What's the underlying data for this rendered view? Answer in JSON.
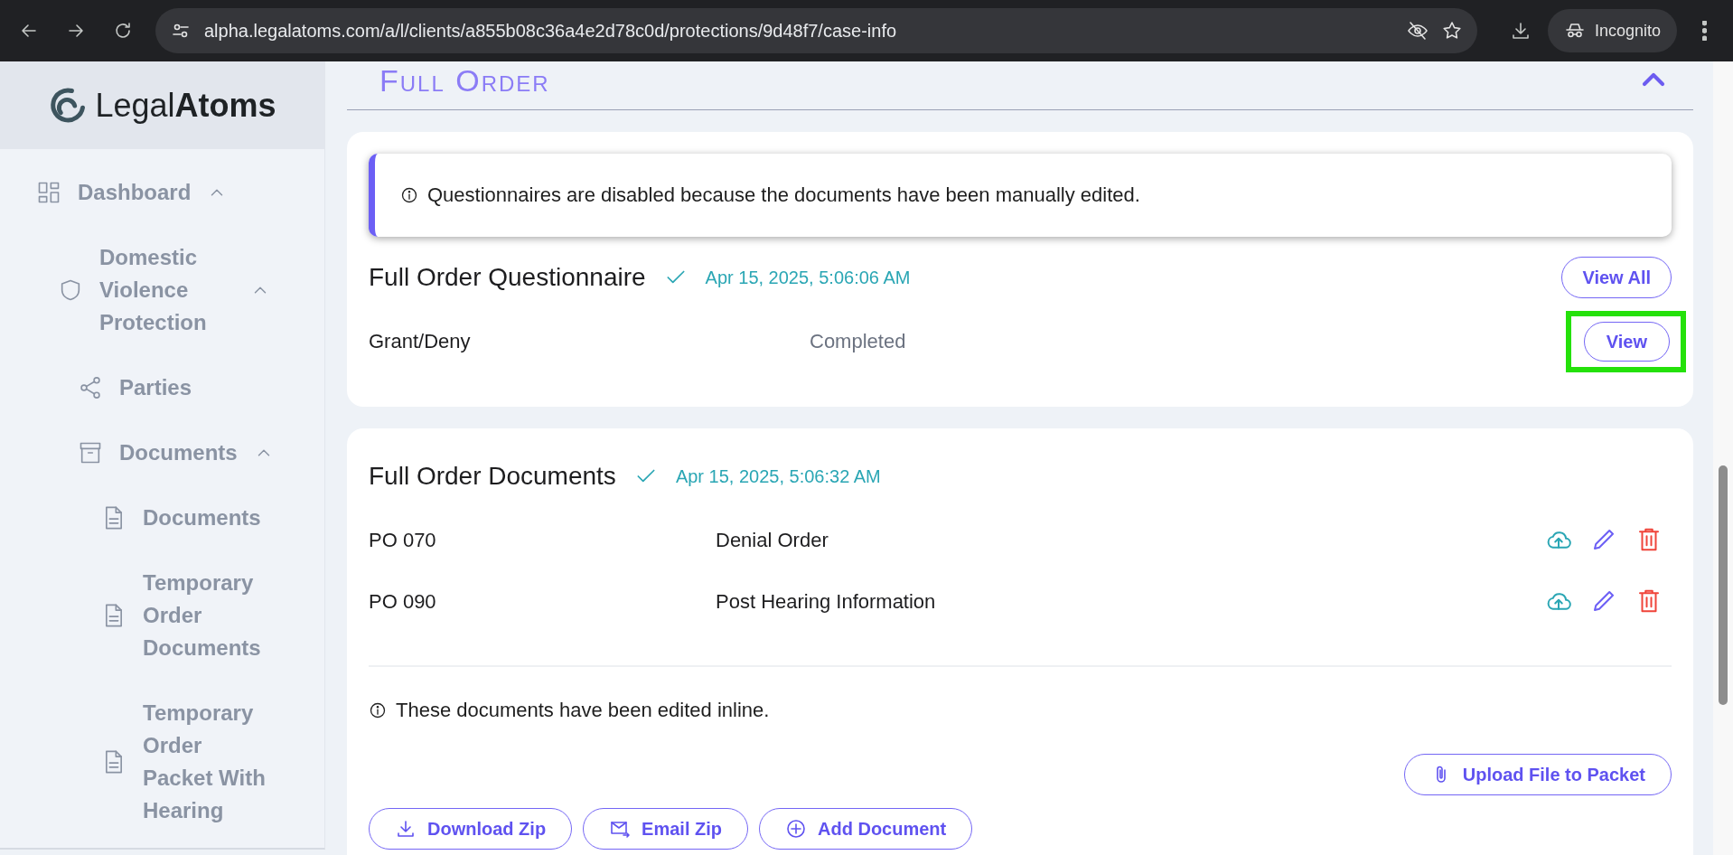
{
  "browser": {
    "url": "alpha.legalatoms.com/a/l/clients/a855b08c36a4e2d78c0d/protections/9d48f7/case-info",
    "profile_label": "Incognito"
  },
  "sidebar": {
    "logo": {
      "light": "Legal",
      "bold": "Atoms"
    },
    "items": [
      {
        "label": "Dashboard",
        "kind": "grid",
        "expanded": true,
        "children": [
          {
            "label": "Domestic Violence Protection",
            "kind": "shield",
            "expanded": true,
            "children": [
              {
                "label": "Parties",
                "kind": "share"
              },
              {
                "label": "Documents",
                "kind": "archive",
                "expanded": true,
                "children": [
                  {
                    "label": "Documents",
                    "kind": "file"
                  },
                  {
                    "label": "Temporary Order Documents",
                    "kind": "file"
                  },
                  {
                    "label": "Temporary Order Packet With Hearing",
                    "kind": "file"
                  }
                ]
              }
            ]
          }
        ]
      }
    ]
  },
  "section": {
    "title": "Full Order",
    "expanded": true
  },
  "questionnaire": {
    "alert": "Questionnaires are disabled because the documents have been manually edited.",
    "title": "Full Order Questionnaire",
    "completed": true,
    "timestamp": "Apr 15, 2025, 5:06:06 AM",
    "view_all": "View All",
    "rows": [
      {
        "name": "Grant/Deny",
        "status": "Completed",
        "action": "View",
        "highlighted": true
      }
    ]
  },
  "documents": {
    "title": "Full Order Documents",
    "completed": true,
    "timestamp": "Apr 15, 2025, 5:06:32 AM",
    "rows": [
      {
        "code": "PO 070",
        "name": "Denial Order"
      },
      {
        "code": "PO 090",
        "name": "Post Hearing Information"
      }
    ],
    "note": "These documents have been edited inline.",
    "upload": "Upload File to Packet",
    "buttons": [
      {
        "label": "Download Zip",
        "kind": "download"
      },
      {
        "label": "Email Zip",
        "kind": "email"
      },
      {
        "label": "Add Document",
        "kind": "add"
      }
    ]
  }
}
